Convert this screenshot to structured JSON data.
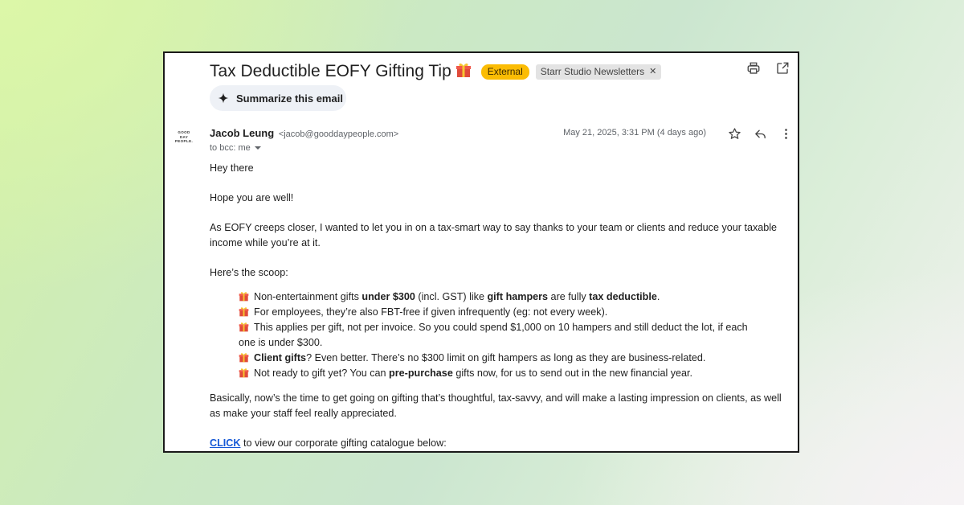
{
  "email": {
    "subject": "Tax Deductible EOFY Gifting Tip",
    "tag_external": "External",
    "tag_label": "Starr Studio Newsletters",
    "summarize_label": "Summarize this email",
    "avatar_text": "GOOD DAY PEOPLE.",
    "sender_name": "Jacob Leung",
    "sender_email": "<jacob@gooddaypeople.com>",
    "recipient": "to bcc: me",
    "date": "May 21, 2025, 3:31 PM (4 days ago)"
  },
  "body": {
    "greeting": "Hey there",
    "p1": "Hope you are well!",
    "p2a": "As EOFY creeps closer, I wanted to let you in on a tax-smart way to say thanks to your team or clients and reduce your taxable",
    "p2b": "income while you’re at it.",
    "p3": "Here’s the scoop:",
    "b1": {
      "t1": "Non-entertainment gifts ",
      "b1": "under $300",
      "t2": " (incl. GST) like ",
      "b2": "gift hampers",
      "t3": " are fully ",
      "b3": "tax deductible",
      "t4": "."
    },
    "b2": "For employees, they’re also FBT-free if given infrequently (eg: not every week).",
    "b3a": "This applies per gift, not per invoice. So you could spend $1,000 on 10 hampers and still deduct the lot, if each",
    "b3b": "one is under $300.",
    "b4": {
      "bold": "Client gifts",
      "rest": "? Even better. There’s no $300 limit on gift hampers as long as they are business-related."
    },
    "b5": {
      "t1": "Not ready to gift yet? You can ",
      "bold": "pre-purchase",
      "t2": " gifts now, for us to send out in the new financial year."
    },
    "p4a": "Basically, now’s the time to get going on gifting that’s thoughtful, tax-savvy, and will make a lasting impression on clients, as well",
    "p4b": "as make your staff feel really appreciated.",
    "cta_link": "CLICK",
    "cta_rest": " to view our corporate gifting catalogue below:"
  },
  "icons": {
    "print": "print-icon",
    "open": "open-in-new-icon",
    "star": "star-icon",
    "reply": "reply-icon",
    "more": "more-vert-icon",
    "spark": "sparkle-icon",
    "gift": "gift-icon"
  },
  "colors": {
    "external_tag": "#fbbc04",
    "link": "#1558d6",
    "summarize_bg": "#eef1f6"
  }
}
